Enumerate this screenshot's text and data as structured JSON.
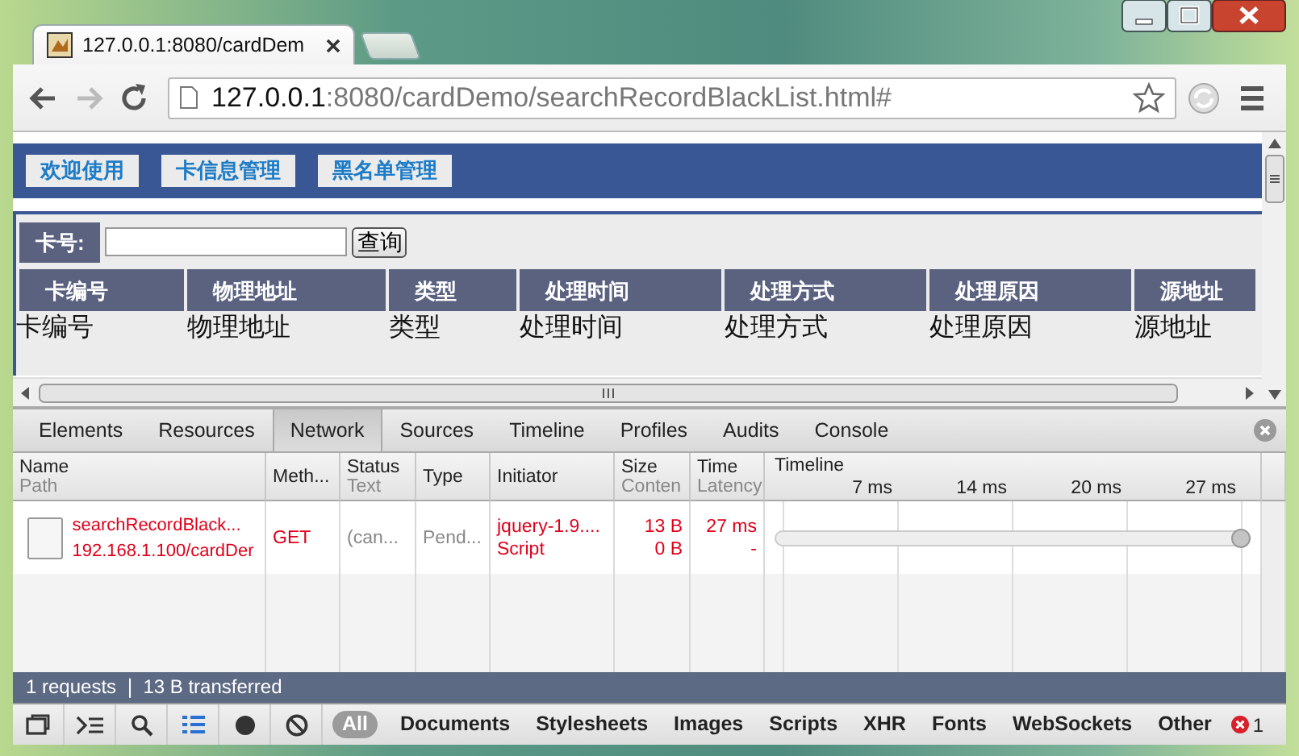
{
  "window": {
    "tab_title": "127.0.0.1:8080/cardDem",
    "url_host": "127.0.0.1",
    "url_path": ":8080/cardDemo/searchRecordBlackList.html#"
  },
  "page": {
    "nav": [
      "欢迎使用",
      "卡信息管理",
      "黑名单管理"
    ],
    "search": {
      "label": "卡号:",
      "button": "查询"
    },
    "table": {
      "columns": [
        "卡编号",
        "物理地址",
        "类型",
        "处理时间",
        "处理方式",
        "处理原因",
        "源地址"
      ],
      "rows": [
        [
          "卡编号",
          "物理地址",
          "类型",
          "处理时间",
          "处理方式",
          "处理原因",
          "源地址"
        ]
      ]
    }
  },
  "devtools": {
    "tabs": [
      {
        "label": "Elements",
        "selected": false
      },
      {
        "label": "Resources",
        "selected": false
      },
      {
        "label": "Network",
        "selected": true
      },
      {
        "label": "Sources",
        "selected": false
      },
      {
        "label": "Timeline",
        "selected": false
      },
      {
        "label": "Profiles",
        "selected": false
      },
      {
        "label": "Audits",
        "selected": false
      },
      {
        "label": "Console",
        "selected": false
      }
    ],
    "columns": [
      {
        "title": "Name",
        "subtitle": "Path"
      },
      {
        "title": "Meth..."
      },
      {
        "title": "Status",
        "subtitle": "Text"
      },
      {
        "title": "Type"
      },
      {
        "title": "Initiator"
      },
      {
        "title": "Size",
        "subtitle": "Conten"
      },
      {
        "title": "Time",
        "subtitle": "Latency"
      }
    ],
    "timeline": {
      "title": "Timeline",
      "ticks": [
        "7 ms",
        "14 ms",
        "20 ms",
        "27 ms"
      ]
    },
    "requests": [
      {
        "name": "searchRecordBlack...",
        "path": "192.168.1.100/cardDer",
        "method": "GET",
        "status": "(can...",
        "type": "Pend...",
        "initiator": "jquery-1.9....",
        "initiator_type": "Script",
        "size": "13 B",
        "content": "0 B",
        "time": "27 ms",
        "latency": "-"
      }
    ],
    "status": "1 requests ❘ 13 B transferred",
    "filters": [
      {
        "label": "All",
        "selected": true
      },
      {
        "label": "Documents",
        "selected": false
      },
      {
        "label": "Stylesheets",
        "selected": false
      },
      {
        "label": "Images",
        "selected": false
      },
      {
        "label": "Scripts",
        "selected": false
      },
      {
        "label": "XHR",
        "selected": false
      },
      {
        "label": "Fonts",
        "selected": false
      },
      {
        "label": "WebSockets",
        "selected": false
      },
      {
        "label": "Other",
        "selected": false
      }
    ],
    "error_count": "1"
  }
}
